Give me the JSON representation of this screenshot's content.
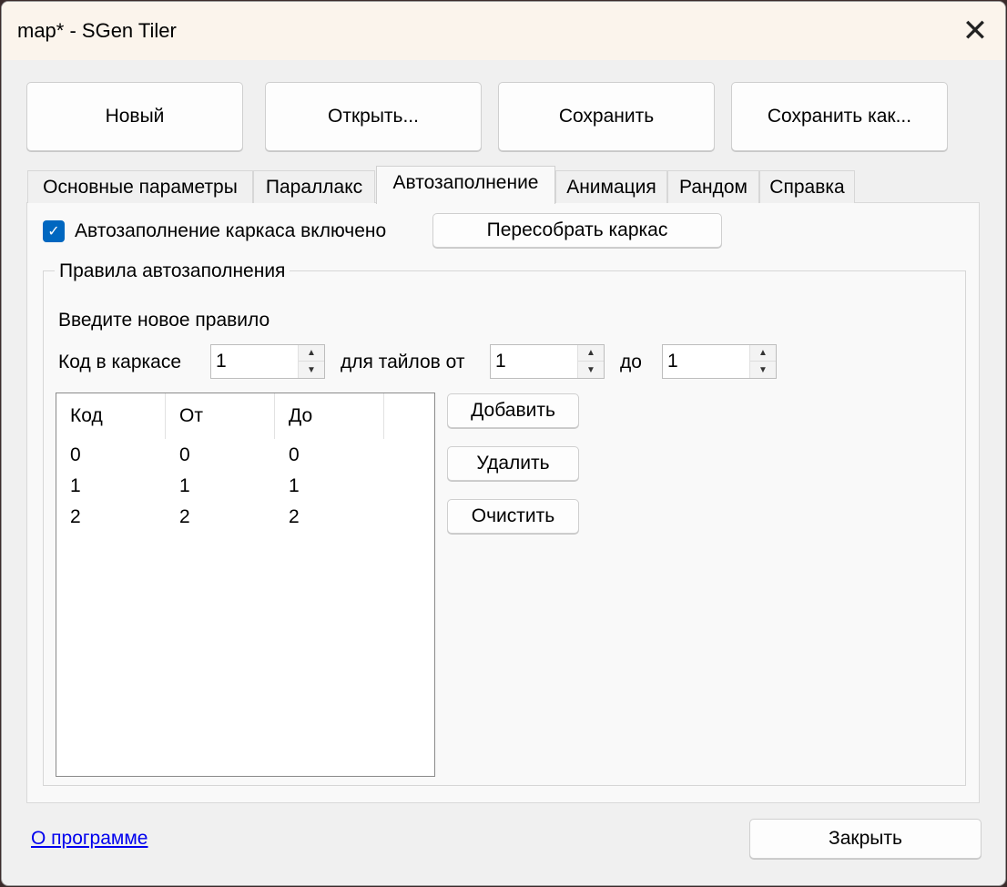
{
  "window": {
    "title": "map* - SGen Tiler"
  },
  "toolbar": {
    "new": "Новый",
    "open": "Открыть...",
    "save": "Сохранить",
    "save_as": "Сохранить как..."
  },
  "tabs": [
    "Основные параметры",
    "Параллакс",
    "Автозаполнение",
    "Анимация",
    "Рандом",
    "Справка"
  ],
  "active_tab": "Автозаполнение",
  "autofill": {
    "enabled_label": "Автозаполнение каркаса включено",
    "enabled": true,
    "rebuild_button": "Пересобрать каркас"
  },
  "rules": {
    "group_title": "Правила автозаполнения",
    "prompt": "Введите новое правило",
    "code_label": "Код в каркасе",
    "code_value": "1",
    "from_label": "для тайлов от",
    "from_value": "1",
    "to_label": "до",
    "to_value": "1",
    "columns": [
      "Код",
      "От",
      "До"
    ],
    "rows": [
      [
        "0",
        "0",
        "0"
      ],
      [
        "1",
        "1",
        "1"
      ],
      [
        "2",
        "2",
        "2"
      ]
    ],
    "add": "Добавить",
    "delete": "Удалить",
    "clear": "Очистить"
  },
  "footer": {
    "about": "О программе",
    "close": "Закрыть"
  },
  "colors": {
    "accent": "#0067c0",
    "link": "#0000ee",
    "titlebar": "#fbf4ec"
  }
}
